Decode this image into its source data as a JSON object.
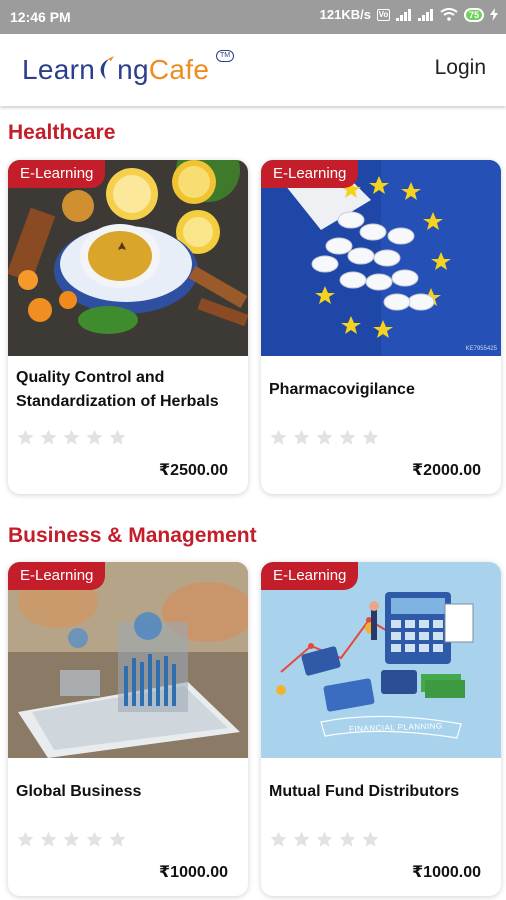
{
  "status_bar": {
    "time": "12:46 PM",
    "speed": "121KB/s",
    "vo_label": "Vo",
    "battery": "75"
  },
  "header": {
    "logo_part1": "Learn",
    "logo_part2": "ng",
    "logo_part3": "Cafe",
    "logo_tm": "TM",
    "login_label": "Login"
  },
  "colors": {
    "accent": "#c41e2a",
    "logo_blue": "#2b3e8c",
    "logo_orange": "#f08b1f",
    "star_empty": "#e2e2e2"
  },
  "sections": [
    {
      "title": "Healthcare",
      "courses": [
        {
          "badge": "E-Learning",
          "title": "Quality Control and Standardization of Herbals",
          "price": "₹2500.00",
          "rating": 0,
          "image": "herbal-tea-image"
        },
        {
          "badge": "E-Learning",
          "title": "Pharmacovigilance",
          "price": "₹2000.00",
          "rating": 0,
          "image": "pills-eu-flag-image",
          "image_caption": "KE7955425"
        }
      ]
    },
    {
      "title": "Business & Management",
      "courses": [
        {
          "badge": "E-Learning",
          "title": "Global Business",
          "price": "₹1000.00",
          "rating": 0,
          "image": "tablet-analytics-image"
        },
        {
          "badge": "E-Learning",
          "title": "Mutual Fund Distributors",
          "price": "₹1000.00",
          "rating": 0,
          "image": "financial-planning-image",
          "image_caption": "FINANCIAL PLANNING"
        }
      ]
    }
  ]
}
